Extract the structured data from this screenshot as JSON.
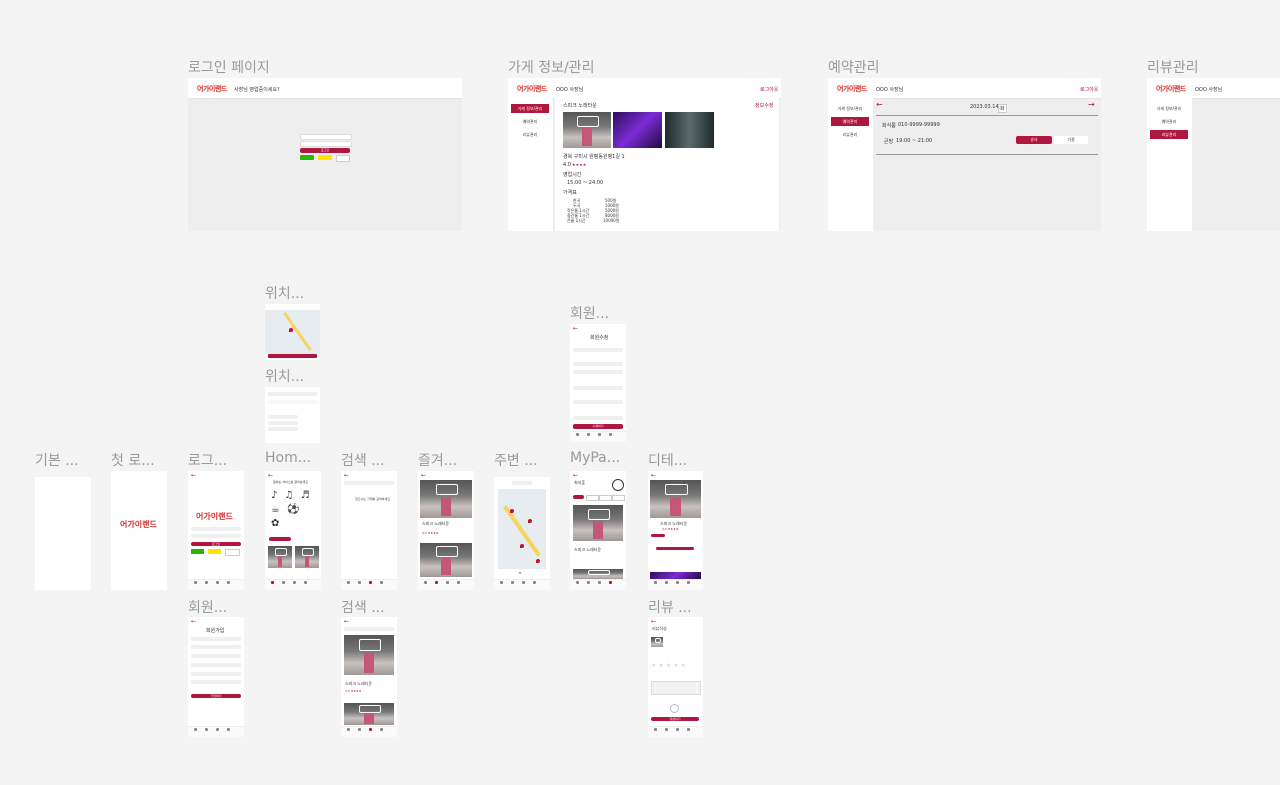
{
  "brand": {
    "primary": "#b0173e",
    "logo_red": "#d42b2b",
    "canvas_bg": "#f4f4f4"
  },
  "labels": {
    "login_page": "로그인 페이지",
    "store_info": "가게 정보/관리",
    "reservation": "예약관리",
    "review": "리뷰관리",
    "location1": "위치...",
    "location2": "위치...",
    "member1": "회원...",
    "basic": "기본 ...",
    "first": "첫 로...",
    "login": "로그...",
    "home": "Hom...",
    "search1": "검색 ...",
    "favorite": "즐겨...",
    "nearby": "주변 ...",
    "mypage": "MyPa...",
    "detail": "디테...",
    "member2": "회원...",
    "search2": "검색 ...",
    "review2": "리뷰 ..."
  },
  "login_admin": {
    "logo": "어가이랜드",
    "question": "사장님 영업중이세요?",
    "login_btn": "로그인"
  },
  "admin": {
    "logo": "어가이랜드",
    "owner": "OOO 사장님",
    "logout": "로그아웃",
    "menu_store": "가게 정보/관리",
    "menu_reservation": "예약관리",
    "menu_review": "리뷰관리"
  },
  "store": {
    "name": "스피크 노래타운",
    "edit": "정보수정",
    "address": "경북 구미시 원평동원평1길 1",
    "rating": "4.0",
    "stars": "★★★★",
    "hours_label": "영업시간",
    "hours": "15:00 ~ 24:00",
    "price_label": "가격표",
    "prices": [
      {
        "item": "한곡",
        "price": "500원"
      },
      {
        "item": "두곡",
        "price": "1000원"
      },
      {
        "item": "작은룸 1시간",
        "price": "5000원"
      },
      {
        "item": "중간룸 1시간",
        "price": "8000원"
      },
      {
        "item": "큰룸 1시간",
        "price": "10000원"
      }
    ],
    "sign_text": "~노래타운"
  },
  "reservation": {
    "date": "2023.03.14",
    "date_tag": "화",
    "customer_label": "회식룸",
    "phone": "010-9999-99999",
    "room": "큰방",
    "time": "19:00 ~ 21:00",
    "accept": "승낙",
    "reject": "거절"
  },
  "member_form": {
    "title": "회원수정",
    "title2": "회원가입",
    "submit": "수정하기",
    "submit2": "가입하기"
  },
  "mobile": {
    "first_logo": "어가이랜드",
    "home_prompt": "원하는 서비스를 골라보세요",
    "search_empty": "찾으시는 가게를 검색하세요",
    "review_title": "리뷰작성",
    "review_btn": "작성하기",
    "store_name": "스피크 노래타운",
    "rating_row": "4.0 ★★★★",
    "mypage_name": "최지훈"
  }
}
